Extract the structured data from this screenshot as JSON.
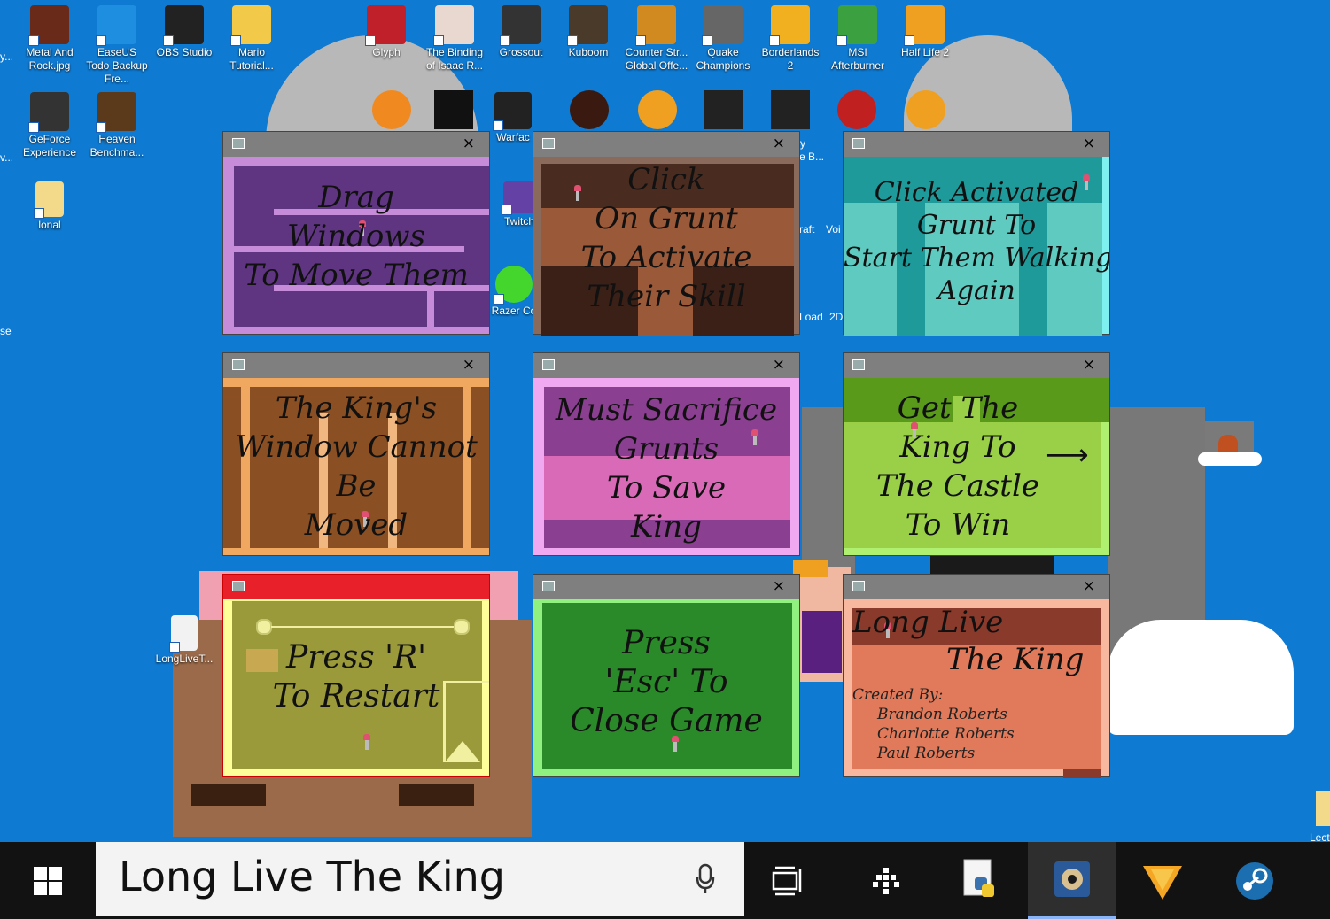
{
  "desktop_icons_top": [
    {
      "label": "Metal And Rock.jpg",
      "icon": "image-file-icon",
      "color": "#6a2a1a"
    },
    {
      "label": "EaseUS Todo Backup Fre...",
      "icon": "easeus-icon",
      "color": "#1e8fe0"
    },
    {
      "label": "OBS Studio",
      "icon": "obs-icon",
      "color": "#222222"
    },
    {
      "label": "Mario Tutorial...",
      "icon": "folder-icon",
      "color": "#f3c94a"
    },
    {
      "label": "Glyph",
      "icon": "glyph-icon",
      "color": "#c0202a"
    },
    {
      "label": "The Binding of Isaac R...",
      "icon": "isaac-icon",
      "color": "#e8d8d0"
    },
    {
      "label": "Grossout",
      "icon": "grossout-icon",
      "color": "#333333"
    },
    {
      "label": "Kuboom",
      "icon": "kuboom-icon",
      "color": "#4a3a2a"
    },
    {
      "label": "Counter Str... Global Offe...",
      "icon": "csgo-icon",
      "color": "#d08a20"
    },
    {
      "label": "Quake Champions",
      "icon": "quake-icon",
      "color": "#666666"
    },
    {
      "label": "Borderlands 2",
      "icon": "borderlands-icon",
      "color": "#f0b020"
    },
    {
      "label": "MSI Afterburner",
      "icon": "afterburner-icon",
      "color": "#3aa040"
    },
    {
      "label": "Half Life 2",
      "icon": "half-life-icon",
      "color": "#f0a020"
    }
  ],
  "desktop_icons_left": [
    {
      "label": "GeForce Experience",
      "icon": "geforce-icon",
      "color": "#333333"
    },
    {
      "label": "Heaven Benchma...",
      "icon": "heaven-icon",
      "color": "#5a3a1a"
    },
    {
      "label": "lonal",
      "icon": "folder-icon",
      "color": "#f3c94a"
    },
    {
      "label": "Twitch",
      "icon": "twitch-icon",
      "color": "#6441a5"
    },
    {
      "label": "Razer Co",
      "icon": "razer-icon",
      "color": "#44d62c"
    },
    {
      "label": "Warfac",
      "icon": "warface-icon",
      "color": "#222222"
    },
    {
      "label": "LongLiveT...",
      "icon": "document-icon",
      "color": "#f3c94a"
    }
  ],
  "partial_labels": {
    "left_edge_1": "y...",
    "left_edge_2": "v...",
    "left_edge_3": "se",
    "craft": "raft",
    "voi": "Voi",
    "load": "Load",
    "twod": "2D",
    "yb_1": "y",
    "yb_2": "e B...",
    "lect": "Lect"
  },
  "game_windows": [
    {
      "id": "drag",
      "lines": [
        "Drag",
        "Windows",
        "To Move Them"
      ],
      "bg": "#5f3581"
    },
    {
      "id": "click",
      "lines": [
        "Click",
        "On Grunt",
        "To Activate",
        "Their Skill"
      ],
      "bg": "#4a2b1f"
    },
    {
      "id": "activated",
      "lines": [
        "Click Activated",
        "Grunt To",
        "Start Them Walking",
        "Again"
      ],
      "bg": "#23a9a9"
    },
    {
      "id": "kings-window",
      "lines": [
        "The King's",
        "Window Cannot",
        "Be",
        "Moved"
      ],
      "bg": "#8a4f22"
    },
    {
      "id": "sacrifice",
      "lines": [
        "Must Sacrifice",
        "Grunts",
        "To Save",
        "King"
      ],
      "bg": "#8b3f91"
    },
    {
      "id": "castle",
      "lines": [
        "Get The",
        "King To",
        "The Castle",
        "To Win"
      ],
      "bg": "#8cc83a"
    },
    {
      "id": "restart",
      "lines": [
        "Press 'R'",
        "To Restart"
      ],
      "bg": "#9a9a3a"
    },
    {
      "id": "escape",
      "lines": [
        "Press",
        "'Esc' To",
        "Close Game"
      ],
      "bg": "#2a8a2a"
    },
    {
      "id": "credits",
      "title_lines": [
        "Long Live",
        "The King"
      ],
      "credits_label": "Created By:",
      "credits": [
        "Brandon Roberts",
        "Charlotte Roberts",
        "Paul Roberts"
      ],
      "bg": "#e07a5a"
    }
  ],
  "close_glyph": "×",
  "taskbar": {
    "search_text": "Long Live The King",
    "apps": [
      "windows-start-icon",
      "mic-icon",
      "task-view-icon",
      "network-app-icon",
      "python-icon",
      "game-app-icon",
      "vlc-icon",
      "steam-icon"
    ]
  }
}
